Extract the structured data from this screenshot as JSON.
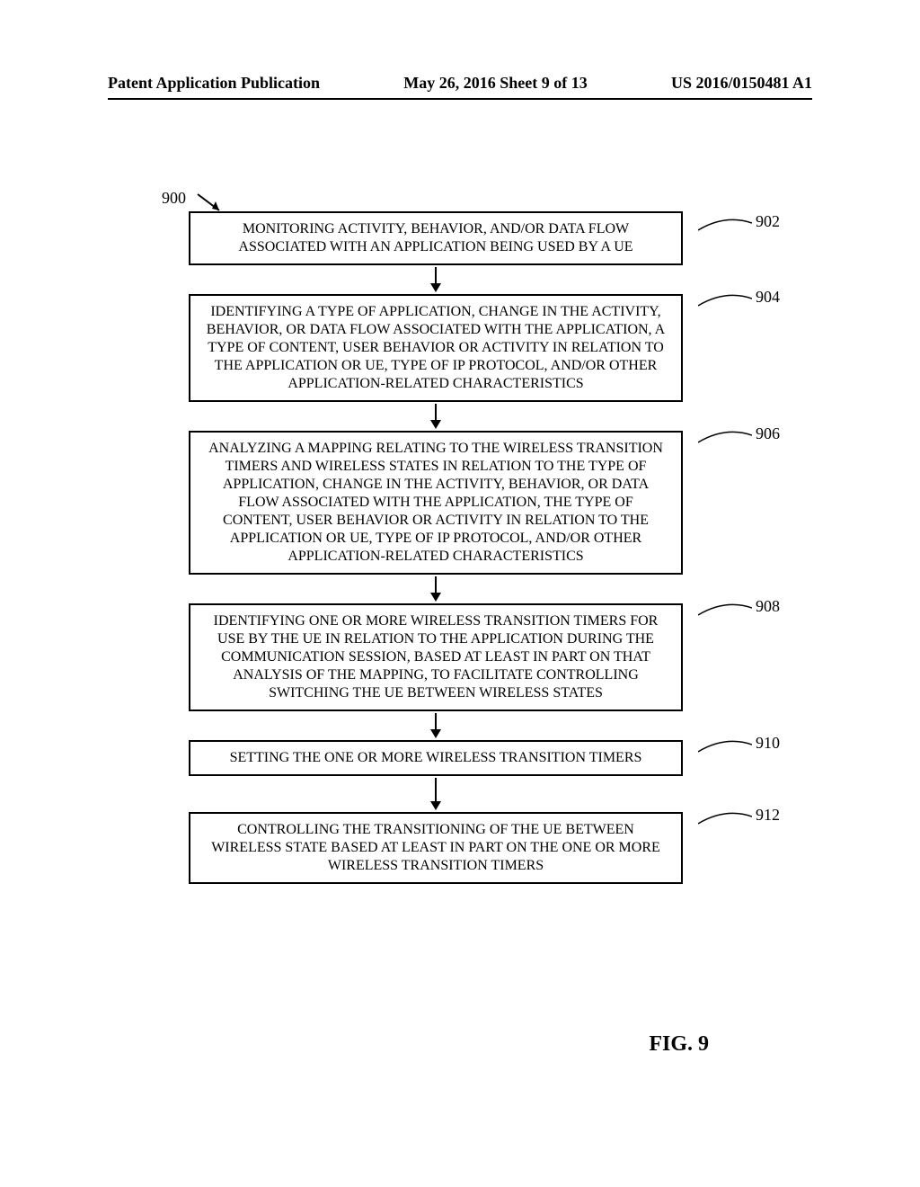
{
  "header": {
    "left": "Patent Application Publication",
    "center": "May 26, 2016  Sheet 9 of 13",
    "right": "US 2016/0150481 A1"
  },
  "figure": {
    "reference_label": "900",
    "caption": "FIG. 9",
    "steps": [
      {
        "callout": "902",
        "text": "MONITORING ACTIVITY, BEHAVIOR, AND/OR DATA FLOW ASSOCIATED WITH AN APPLICATION BEING USED BY A UE"
      },
      {
        "callout": "904",
        "text": "IDENTIFYING A TYPE OF APPLICATION, CHANGE IN THE ACTIVITY, BEHAVIOR, OR DATA FLOW ASSOCIATED WITH THE APPLICATION, A TYPE OF CONTENT, USER BEHAVIOR OR ACTIVITY IN RELATION TO THE APPLICATION OR UE, TYPE OF IP PROTOCOL, AND/OR OTHER APPLICATION-RELATED CHARACTERISTICS"
      },
      {
        "callout": "906",
        "text": "ANALYZING A MAPPING RELATING TO THE WIRELESS TRANSITION TIMERS AND WIRELESS STATES IN RELATION TO THE TYPE OF APPLICATION, CHANGE IN THE ACTIVITY, BEHAVIOR, OR DATA FLOW ASSOCIATED WITH THE APPLICATION, THE TYPE OF CONTENT, USER BEHAVIOR OR ACTIVITY IN RELATION TO THE APPLICATION OR UE, TYPE OF IP PROTOCOL, AND/OR OTHER APPLICATION-RELATED CHARACTERISTICS"
      },
      {
        "callout": "908",
        "text": "IDENTIFYING ONE OR MORE WIRELESS TRANSITION TIMERS FOR USE BY THE UE IN RELATION TO THE APPLICATION DURING THE COMMUNICATION SESSION, BASED AT LEAST IN PART ON THAT ANALYSIS OF THE MAPPING, TO FACILITATE CONTROLLING SWITCHING THE UE BETWEEN WIRELESS STATES"
      },
      {
        "callout": "910",
        "text": "SETTING THE ONE OR MORE WIRELESS TRANSITION TIMERS"
      },
      {
        "callout": "912",
        "text": "CONTROLLING THE TRANSITIONING OF THE UE BETWEEN WIRELESS STATE BASED AT LEAST IN PART ON THE ONE OR MORE WIRELESS TRANSITION TIMERS"
      }
    ]
  }
}
